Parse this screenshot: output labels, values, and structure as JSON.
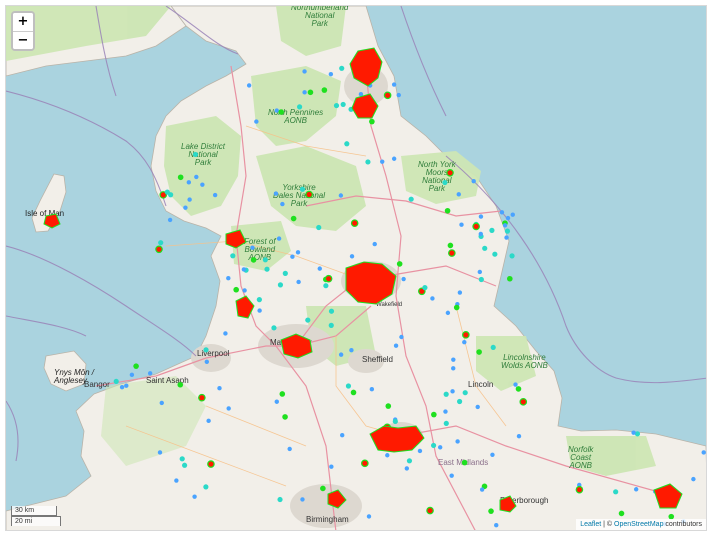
{
  "map": {
    "zoom_in_label": "+",
    "zoom_out_label": "−",
    "scale_km": "30 km",
    "scale_mi": "20 mi",
    "attribution_leaflet": "Leaflet",
    "attribution_sep": "| ©",
    "attribution_osm": "OpenStreetMap",
    "attribution_tail": "contributors",
    "labels": {
      "northumberland": "Northumberland\nNational\nPark",
      "north_pennines": "North Pennines\nAONB",
      "lake_district": "Lake District\nNational\nPark",
      "yorkshire_dales": "Yorkshire\nDales National\nPark",
      "north_york_moors": "North York\nMoors\nNational\nPark",
      "forest_bowland": "Forest of\nBowland\nAONB",
      "isle_of_man": "Isle of Man",
      "ynys_mon": "Ynys Môn /\nAnglesey",
      "liverpool": "Liverpool",
      "manchester": "Manchester",
      "sheffield": "Sheffield",
      "lincolnshire_wolds": "Lincolnshire\nWolds AONB",
      "east_midlands": "East Midlands",
      "birmingham": "Birmingham",
      "peterborough": "Peterborough",
      "lincoln": "Lincoln",
      "wakefield": "Wakefield",
      "saint_asaph": "Saint Asaph",
      "norfolk_coast": "Norfolk\nCoast\nAONB",
      "bangor": "Bangor"
    },
    "marker_colors": {
      "high": "#ff1a00",
      "medium": "#1fe01f",
      "low": "#4aa3ff",
      "mid_low": "#2bd9c8"
    }
  }
}
